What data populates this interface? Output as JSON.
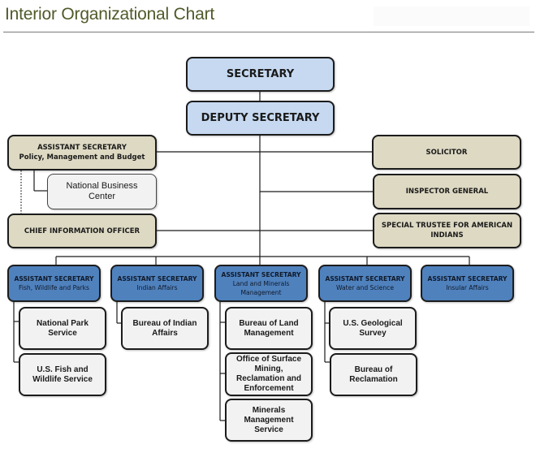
{
  "page": {
    "title": "Interior Organizational Chart"
  },
  "chart": {
    "secretary": {
      "label": "SECRETARY"
    },
    "deputy": {
      "label": "DEPUTY SECRETARY"
    },
    "staff_left": [
      {
        "line1": "ASSISTANT SECRETARY",
        "line2": "Policy, Management and Budget"
      },
      {
        "line1": "CHIEF INFORMATION OFFICER"
      }
    ],
    "nbc": {
      "line1": "National Business",
      "line2": "Center"
    },
    "staff_right": [
      {
        "line1": "SOLICITOR"
      },
      {
        "line1": "INSPECTOR GENERAL"
      },
      {
        "line1": "SPECIAL TRUSTEE FOR AMERICAN",
        "line2": "INDIANS"
      }
    ],
    "assistant_secretaries": [
      {
        "line1": "ASSISTANT SECRETARY",
        "line2": "Fish, Wildlife and Parks",
        "bureaus": [
          {
            "line1": "National Park",
            "line2": "Service"
          },
          {
            "line1": "U.S. Fish and",
            "line2": "Wildlife Service"
          }
        ]
      },
      {
        "line1": "ASSISTANT SECRETARY",
        "line2": "Indian Affairs",
        "bureaus": [
          {
            "line1": "Bureau of Indian",
            "line2": "Affairs"
          }
        ]
      },
      {
        "line1": "ASSISTANT SECRETARY",
        "line2": "Land and Minerals",
        "line3": "Management",
        "bureaus": [
          {
            "line1": "Bureau of Land",
            "line2": "Management"
          },
          {
            "line1": "Office of Surface",
            "line2": "Mining,",
            "line3": "Reclamation and",
            "line4": "Enforcement"
          },
          {
            "line1": "Minerals",
            "line2": "Management",
            "line3": "Service"
          }
        ]
      },
      {
        "line1": "ASSISTANT SECRETARY",
        "line2": "Water and Science",
        "bureaus": [
          {
            "line1": "U.S. Geological",
            "line2": "Survey"
          },
          {
            "line1": "Bureau of",
            "line2": "Reclamation"
          }
        ]
      },
      {
        "line1": "ASSISTANT SECRETARY",
        "line2": "Insular Affairs",
        "bureaus": []
      }
    ]
  }
}
